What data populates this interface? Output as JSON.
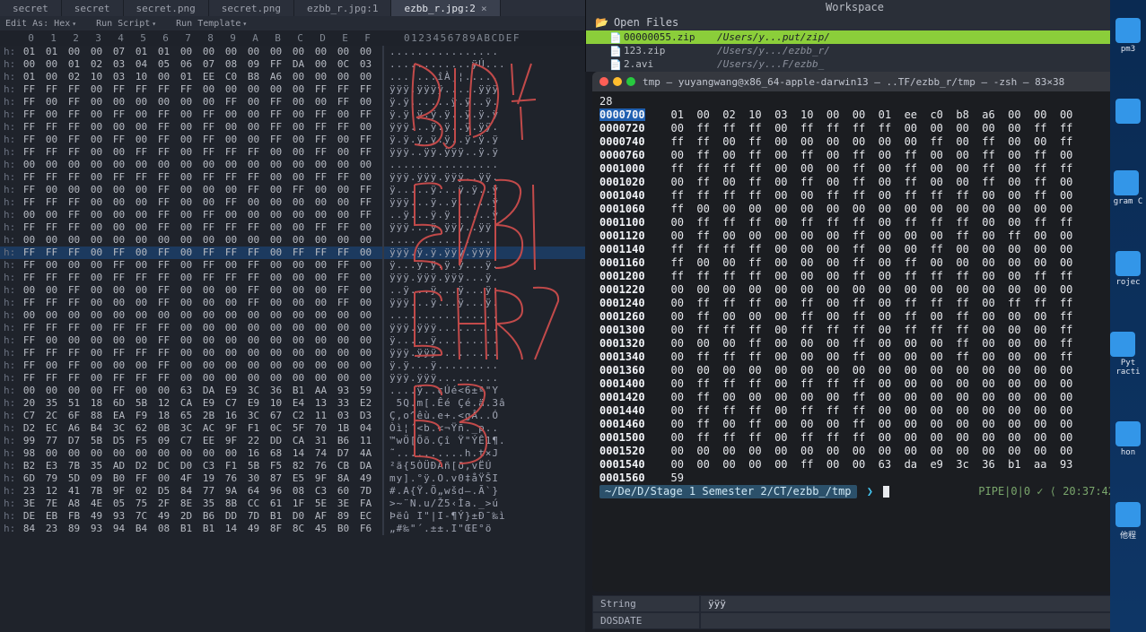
{
  "hex_editor": {
    "tabs": [
      {
        "label": "secret"
      },
      {
        "label": "secret"
      },
      {
        "label": "secret.png"
      },
      {
        "label": "secret.png"
      },
      {
        "label": "ezbb_r.jpg:1"
      },
      {
        "label": "ezbb_r.jpg:2",
        "active": true
      }
    ],
    "toolbar": {
      "edit_as": "Edit As: Hex",
      "run_script": "Run Script",
      "run_template": "Run Template"
    },
    "col_labels": [
      "0",
      "1",
      "2",
      "3",
      "4",
      "5",
      "6",
      "7",
      "8",
      "9",
      "A",
      "B",
      "C",
      "D",
      "E",
      "F"
    ],
    "ascii_header": "0123456789ABCDEF",
    "gutter": "h:",
    "rows": [
      {
        "hex": [
          "01",
          "01",
          "00",
          "00",
          "07",
          "01",
          "01",
          "00",
          "00",
          "00",
          "00",
          "00",
          "00",
          "00",
          "00",
          "00"
        ],
        "ascii": "................"
      },
      {
        "hex": [
          "00",
          "00",
          "01",
          "02",
          "03",
          "04",
          "05",
          "06",
          "07",
          "08",
          "09",
          "FF",
          "DA",
          "00",
          "0C",
          "03"
        ],
        "ascii": "............ÿÚ..."
      },
      {
        "hex": [
          "01",
          "00",
          "02",
          "10",
          "03",
          "10",
          "00",
          "01",
          "EE",
          "C0",
          "B8",
          "A6",
          "00",
          "00",
          "00",
          "00"
        ],
        "ascii": ".......îÀ¸¦....."
      },
      {
        "hex": [
          "FF",
          "FF",
          "FF",
          "00",
          "FF",
          "FF",
          "FF",
          "FF",
          "00",
          "00",
          "00",
          "00",
          "00",
          "FF",
          "FF",
          "FF"
        ],
        "ascii": "ÿÿÿ.ÿÿÿÿ.....ÿÿÿ"
      },
      {
        "hex": [
          "FF",
          "00",
          "FF",
          "00",
          "00",
          "00",
          "00",
          "00",
          "00",
          "FF",
          "00",
          "FF",
          "00",
          "00",
          "FF",
          "00"
        ],
        "ascii": "ÿ.ÿ......ÿ.ÿ..ÿ."
      },
      {
        "hex": [
          "FF",
          "00",
          "FF",
          "00",
          "FF",
          "00",
          "FF",
          "00",
          "FF",
          "00",
          "00",
          "FF",
          "00",
          "FF",
          "00",
          "FF"
        ],
        "ascii": "ÿ.ÿ.ÿ.ÿ.ÿ..ÿ.ÿ.ÿ"
      },
      {
        "hex": [
          "FF",
          "FF",
          "FF",
          "00",
          "00",
          "00",
          "FF",
          "00",
          "FF",
          "00",
          "00",
          "FF",
          "00",
          "FF",
          "FF",
          "00"
        ],
        "ascii": "ÿÿÿ...ÿ.ÿ..ÿ.ÿÿ."
      },
      {
        "hex": [
          "FF",
          "00",
          "FF",
          "00",
          "FF",
          "00",
          "FF",
          "00",
          "FF",
          "00",
          "00",
          "FF",
          "00",
          "FF",
          "00",
          "FF"
        ],
        "ascii": "ÿ.ÿ.ÿ.ÿ.ÿ..ÿ.ÿ.ÿ"
      },
      {
        "hex": [
          "FF",
          "FF",
          "FF",
          "00",
          "00",
          "FF",
          "FF",
          "00",
          "FF",
          "FF",
          "FF",
          "00",
          "00",
          "FF",
          "00",
          "FF"
        ],
        "ascii": "ÿÿÿ..ÿÿ.ÿÿÿ..ÿ.ÿ"
      },
      {
        "hex": [
          "00",
          "00",
          "00",
          "00",
          "00",
          "00",
          "00",
          "00",
          "00",
          "00",
          "00",
          "00",
          "00",
          "00",
          "00",
          "00"
        ],
        "ascii": "................"
      },
      {
        "hex": [
          "FF",
          "FF",
          "FF",
          "00",
          "FF",
          "FF",
          "FF",
          "00",
          "FF",
          "FF",
          "FF",
          "00",
          "00",
          "FF",
          "FF",
          "00"
        ],
        "ascii": "ÿÿÿ.ÿÿÿ.ÿÿÿ..ÿÿ."
      },
      {
        "hex": [
          "FF",
          "00",
          "00",
          "00",
          "00",
          "00",
          "FF",
          "00",
          "00",
          "00",
          "FF",
          "00",
          "FF",
          "00",
          "00",
          "FF"
        ],
        "ascii": "ÿ.....ÿ...ÿ.ÿ..ÿ"
      },
      {
        "hex": [
          "FF",
          "FF",
          "FF",
          "00",
          "00",
          "00",
          "FF",
          "00",
          "00",
          "FF",
          "00",
          "00",
          "00",
          "00",
          "00",
          "FF"
        ],
        "ascii": "ÿÿÿ...ÿ..ÿ.....ÿ"
      },
      {
        "hex": [
          "00",
          "00",
          "FF",
          "00",
          "00",
          "00",
          "FF",
          "00",
          "FF",
          "00",
          "00",
          "00",
          "00",
          "00",
          "00",
          "FF"
        ],
        "ascii": "..ÿ...ÿ.ÿ......ÿ"
      },
      {
        "hex": [
          "FF",
          "FF",
          "FF",
          "00",
          "00",
          "00",
          "FF",
          "00",
          "FF",
          "FF",
          "FF",
          "00",
          "00",
          "FF",
          "FF",
          "00"
        ],
        "ascii": "ÿÿÿ...ÿ.ÿÿÿ..ÿÿ."
      },
      {
        "hex": [
          "00",
          "00",
          "00",
          "00",
          "00",
          "00",
          "00",
          "00",
          "00",
          "00",
          "00",
          "00",
          "00",
          "00",
          "00",
          "00"
        ],
        "ascii": "................"
      },
      {
        "hex": [
          "FF",
          "FF",
          "FF",
          "00",
          "FF",
          "00",
          "FF",
          "00",
          "FF",
          "FF",
          "FF",
          "00",
          "FF",
          "FF",
          "FF",
          "00"
        ],
        "ascii": "ÿÿÿ.ÿ.ÿ.ÿÿÿ.ÿÿÿ.",
        "sel": true
      },
      {
        "hex": [
          "FF",
          "00",
          "00",
          "00",
          "FF",
          "00",
          "FF",
          "00",
          "FF",
          "00",
          "FF",
          "00",
          "00",
          "00",
          "FF",
          "00"
        ],
        "ascii": "ÿ...ÿ.ÿ.ÿ.ÿ...ÿ."
      },
      {
        "hex": [
          "FF",
          "FF",
          "FF",
          "00",
          "FF",
          "FF",
          "FF",
          "00",
          "FF",
          "FF",
          "FF",
          "00",
          "00",
          "00",
          "FF",
          "00"
        ],
        "ascii": "ÿÿÿ.ÿÿÿ.ÿÿÿ...ÿ."
      },
      {
        "hex": [
          "00",
          "00",
          "FF",
          "00",
          "00",
          "00",
          "FF",
          "00",
          "00",
          "00",
          "FF",
          "00",
          "00",
          "00",
          "FF",
          "00"
        ],
        "ascii": "..ÿ...ÿ...ÿ...ÿ."
      },
      {
        "hex": [
          "FF",
          "FF",
          "FF",
          "00",
          "00",
          "00",
          "FF",
          "00",
          "00",
          "00",
          "FF",
          "00",
          "00",
          "00",
          "FF",
          "00"
        ],
        "ascii": "ÿÿÿ...ÿ...ÿ...ÿ."
      },
      {
        "hex": [
          "00",
          "00",
          "00",
          "00",
          "00",
          "00",
          "00",
          "00",
          "00",
          "00",
          "00",
          "00",
          "00",
          "00",
          "00",
          "00"
        ],
        "ascii": "................"
      },
      {
        "hex": [
          "FF",
          "FF",
          "FF",
          "00",
          "FF",
          "FF",
          "FF",
          "00",
          "00",
          "00",
          "00",
          "00",
          "00",
          "00",
          "00",
          "00"
        ],
        "ascii": "ÿÿÿ.ÿÿÿ........."
      },
      {
        "hex": [
          "FF",
          "00",
          "00",
          "00",
          "00",
          "00",
          "FF",
          "00",
          "00",
          "00",
          "00",
          "00",
          "00",
          "00",
          "00",
          "00"
        ],
        "ascii": "ÿ.....ÿ........."
      },
      {
        "hex": [
          "FF",
          "FF",
          "FF",
          "00",
          "FF",
          "FF",
          "FF",
          "00",
          "00",
          "00",
          "00",
          "00",
          "00",
          "00",
          "00",
          "00"
        ],
        "ascii": "ÿÿÿ.ÿÿÿ........."
      },
      {
        "hex": [
          "FF",
          "00",
          "FF",
          "00",
          "00",
          "00",
          "FF",
          "00",
          "00",
          "00",
          "00",
          "00",
          "00",
          "00",
          "00",
          "00"
        ],
        "ascii": "ÿ.ÿ...ÿ........."
      },
      {
        "hex": [
          "FF",
          "FF",
          "FF",
          "00",
          "FF",
          "FF",
          "FF",
          "00",
          "00",
          "00",
          "00",
          "00",
          "00",
          "00",
          "00",
          "00"
        ],
        "ascii": "ÿÿÿ.ÿÿÿ........."
      },
      {
        "hex": [
          "00",
          "00",
          "00",
          "00",
          "FF",
          "00",
          "00",
          "63",
          "DA",
          "E9",
          "3C",
          "36",
          "B1",
          "AA",
          "93",
          "59"
        ],
        "ascii": "....ÿ..cÚé<6±ª\"Y"
      },
      {
        "hex": [
          "20",
          "35",
          "51",
          "18",
          "6D",
          "5B",
          "12",
          "CA",
          "E9",
          "C7",
          "E9",
          "10",
          "E4",
          "13",
          "33",
          "E2"
        ],
        "ascii": " 5Q.m[.Êé Çé.ä.3â"
      },
      {
        "hex": [
          "C7",
          "2C",
          "6F",
          "88",
          "EA",
          "F9",
          "18",
          "65",
          "2B",
          "16",
          "3C",
          "67",
          "C2",
          "11",
          "03",
          "D3"
        ],
        "ascii": "Ç,o^êù.e+.<gÂ..Ó"
      },
      {
        "hex": [
          "D2",
          "EC",
          "A6",
          "B4",
          "3C",
          "62",
          "0B",
          "3C",
          "AC",
          "9F",
          "F1",
          "0C",
          "5F",
          "70",
          "1B",
          "04"
        ],
        "ascii": "Òì¦´<b.<¬Ÿñ._p.."
      },
      {
        "hex": [
          "99",
          "77",
          "D7",
          "5B",
          "D5",
          "F5",
          "09",
          "C7",
          "EE",
          "9F",
          "22",
          "DD",
          "CA",
          "31",
          "B6",
          "11"
        ],
        "ascii": "™wÖ[Õõ.Çî Ÿ\"ÝÊ1¶."
      },
      {
        "hex": [
          "98",
          "00",
          "00",
          "00",
          "00",
          "00",
          "00",
          "00",
          "00",
          "00",
          "16",
          "68",
          "14",
          "74",
          "D7",
          "4A"
        ],
        "ascii": "˜..........h.t×J"
      },
      {
        "hex": [
          "B2",
          "E3",
          "7B",
          "35",
          "AD",
          "D2",
          "DC",
          "D0",
          "C3",
          "F1",
          "5B",
          "F5",
          "82",
          "76",
          "CB",
          "DA"
        ],
        "ascii": "²ã{5­ÒÜÐÃñ[õ‚vËÚ"
      },
      {
        "hex": [
          "6D",
          "79",
          "5D",
          "09",
          "B0",
          "FF",
          "00",
          "4F",
          "19",
          "76",
          "30",
          "87",
          "E5",
          "9F",
          "8A",
          "49"
        ],
        "ascii": "my].°ÿ.O.v0‡åŸŠI"
      },
      {
        "hex": [
          "23",
          "12",
          "41",
          "7B",
          "9F",
          "02",
          "D5",
          "84",
          "77",
          "9A",
          "64",
          "96",
          "08",
          "C3",
          "60",
          "7D"
        ],
        "ascii": "#.A{Ÿ.Õ„wšd–.Ã`}"
      },
      {
        "hex": [
          "3E",
          "7E",
          "A8",
          "4E",
          "05",
          "75",
          "2F",
          "8E",
          "35",
          "8B",
          "CC",
          "61",
          "1F",
          "5E",
          "3E",
          "FA"
        ],
        "ascii": ">~¨N.u/Ž5‹Ìa._>ú"
      },
      {
        "hex": [
          "DE",
          "EB",
          "FB",
          "49",
          "93",
          "7C",
          "49",
          "2D",
          "B6",
          "DD",
          "7D",
          "B1",
          "D0",
          "AF",
          "89",
          "EC"
        ],
        "ascii": "Þëû I\"|I-¶Ý}±Ð¯‰ì"
      },
      {
        "hex": [
          "84",
          "23",
          "89",
          "93",
          "94",
          "B4",
          "08",
          "B1",
          "B1",
          "14",
          "49",
          "8F",
          "8C",
          "45",
          "B0",
          "F6"
        ],
        "ascii": "„#‰\"´.±±.I\"ŒE°ö"
      }
    ]
  },
  "workspace": {
    "title": "Workspace",
    "open_files_label": "Open Files",
    "files": [
      {
        "name": "00000055.zip",
        "path": "/Users/y...put/zip/",
        "hl": true
      },
      {
        "name": "123.zip",
        "path": "/Users/y.../ezbb_r/"
      },
      {
        "name": "2.avi",
        "path": "/Users/y...F/ezbb_"
      }
    ]
  },
  "terminal": {
    "title": "tmp — yuyangwang@x86_64-apple-darwin13 — ..TF/ezbb_r/tmp — -zsh — 83×38",
    "first_line": "28",
    "rows": [
      {
        "addr": "0000700",
        "bytes": "01  00  02  10  03  10  00  00  01  ee  c0  b8  a6  00  00  00",
        "sel": true
      },
      {
        "addr": "0000720",
        "bytes": "00  ff  ff  ff  00  ff  ff  ff  ff  00  00  00  00  00  ff  ff"
      },
      {
        "addr": "0000740",
        "bytes": "ff  ff  00  ff  00  00  00  00  00  00  ff  00  ff  00  00  ff"
      },
      {
        "addr": "0000760",
        "bytes": "00  ff  00  ff  00  ff  00  ff  00  ff  00  00  ff  00  ff  00"
      },
      {
        "addr": "0001000",
        "bytes": "ff  ff  ff  ff  00  00  00  ff  00  ff  00  00  ff  00  ff  ff"
      },
      {
        "addr": "0001020",
        "bytes": "00  ff  00  ff  00  ff  00  ff  00  ff  00  00  ff  00  ff  00"
      },
      {
        "addr": "0001040",
        "bytes": "ff  ff  ff  ff  00  00  ff  ff  00  ff  ff  ff  00  00  ff  00"
      },
      {
        "addr": "0001060",
        "bytes": "ff  00  00  00  00  00  00  00  00  00  00  00  00  00  00  00"
      },
      {
        "addr": "0001100",
        "bytes": "00  ff  ff  ff  00  ff  ff  ff  00  ff  ff  ff  00  00  ff  ff"
      },
      {
        "addr": "0001120",
        "bytes": "00  ff  00  00  00  00  00  ff  00  00  00  ff  00  ff  00  00"
      },
      {
        "addr": "0001140",
        "bytes": "ff  ff  ff  ff  00  00  00  ff  00  00  ff  00  00  00  00  00"
      },
      {
        "addr": "0001160",
        "bytes": "ff  00  00  ff  00  00  00  ff  00  ff  00  00  00  00  00  00"
      },
      {
        "addr": "0001200",
        "bytes": "ff  ff  ff  ff  00  00  00  ff  00  ff  ff  ff  00  00  ff  ff"
      },
      {
        "addr": "0001220",
        "bytes": "00  00  00  00  00  00  00  00  00  00  00  00  00  00  00  00"
      },
      {
        "addr": "0001240",
        "bytes": "00  ff  ff  ff  00  ff  00  ff  00  ff  ff  ff  00  ff  ff  ff"
      },
      {
        "addr": "0001260",
        "bytes": "00  ff  00  00  00  ff  00  ff  00  ff  00  ff  00  00  00  ff"
      },
      {
        "addr": "0001300",
        "bytes": "00  ff  ff  ff  00  ff  ff  ff  00  ff  ff  ff  00  00  00  ff"
      },
      {
        "addr": "0001320",
        "bytes": "00  00  00  ff  00  00  00  ff  00  00  00  ff  00  00  00  ff"
      },
      {
        "addr": "0001340",
        "bytes": "00  ff  ff  ff  00  00  00  ff  00  00  00  ff  00  00  00  ff"
      },
      {
        "addr": "0001360",
        "bytes": "00  00  00  00  00  00  00  00  00  00  00  00  00  00  00  00"
      },
      {
        "addr": "0001400",
        "bytes": "00  ff  ff  ff  00  ff  ff  ff  00  00  00  00  00  00  00  00"
      },
      {
        "addr": "0001420",
        "bytes": "00  ff  00  00  00  00  00  ff  00  00  00  00  00  00  00  00"
      },
      {
        "addr": "0001440",
        "bytes": "00  ff  ff  ff  00  ff  ff  ff  00  00  00  00  00  00  00  00"
      },
      {
        "addr": "0001460",
        "bytes": "00  ff  00  ff  00  00  00  ff  00  00  00  00  00  00  00  00"
      },
      {
        "addr": "0001500",
        "bytes": "00  ff  ff  ff  00  ff  ff  ff  00  00  00  00  00  00  00  00"
      },
      {
        "addr": "0001520",
        "bytes": "00  00  00  00  00  00  00  00  00  00  00  00  00  00  00  00"
      },
      {
        "addr": "0001540",
        "bytes": "00  00  00  00  00  ff  00  00  63  da  e9  3c  36  b1  aa  93"
      },
      {
        "addr": "0001560",
        "bytes": "59"
      }
    ],
    "prompt": {
      "path": "~/De/D/Stage 1 Semester 2/CT/ezbb_/tmp",
      "right": "PIPE|0|0 ✓ ⟨ 20:37:42"
    }
  },
  "inspector": {
    "rows": [
      {
        "label": "String",
        "value": "ÿÿÿ"
      },
      {
        "label": "DOSDATE",
        "value": ""
      }
    ]
  },
  "desktop": {
    "items": [
      {
        "label": "pm3"
      },
      {
        "label": ""
      },
      {
        "label": "gram C"
      },
      {
        "label": "rojec"
      },
      {
        "label": "Pyt racti"
      },
      {
        "label": "hon"
      },
      {
        "label": "他程"
      }
    ]
  }
}
